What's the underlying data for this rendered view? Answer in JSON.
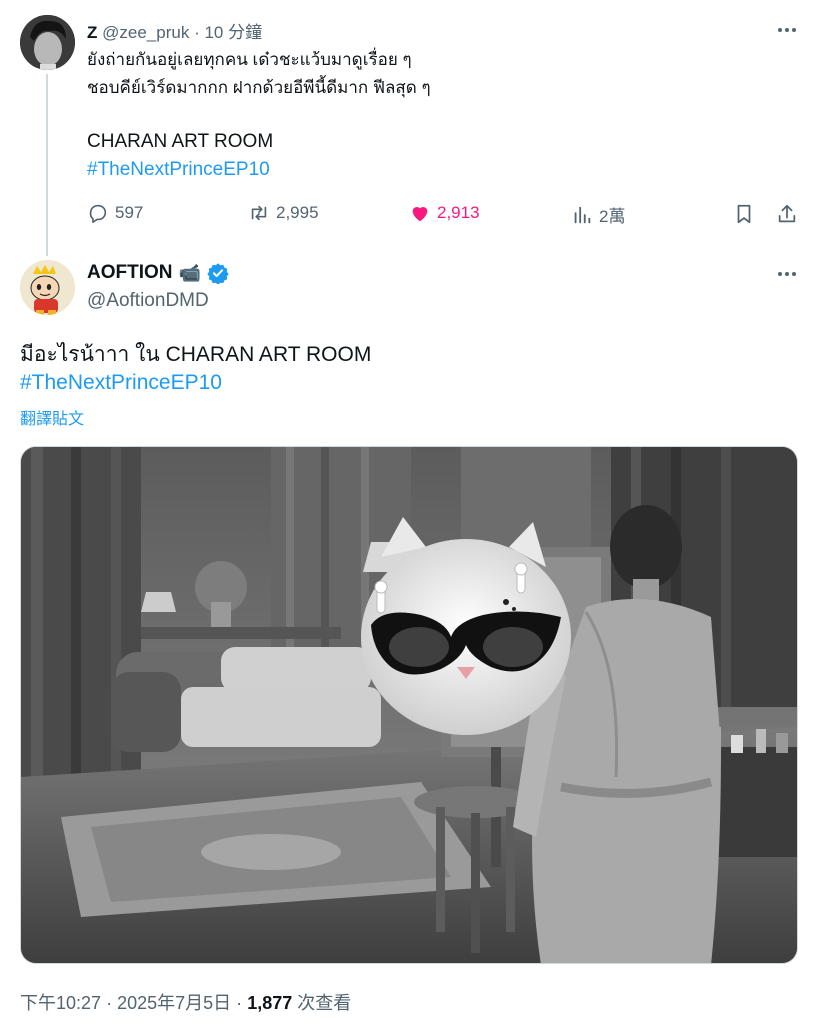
{
  "reply_tweet": {
    "display_name": "Z",
    "handle": "@zee_pruk",
    "separator": "·",
    "time": "10 分鐘",
    "lines": [
      "ยังถ่ายกันอยู่เลยทุกคน เด๋วชะแว้บมาดูเรื่อย ๆ",
      "ชอบคีย์เวิร์ดมากกก ฝากด้วยอีพีนี้ดีมาก ฟีลสุด ๆ"
    ],
    "location": "CHARAN ART ROOM",
    "hashtag": "#TheNextPrinceEP10",
    "replies": "597",
    "retweets": "2,995",
    "likes": "2,913",
    "views": "2萬",
    "colors": {
      "like": "#f91880",
      "link": "#1d9bf0"
    }
  },
  "main_tweet": {
    "display_name": "AOFTION",
    "name_emoji": "📹",
    "verified_icon": "verified-badge-icon",
    "handle": "@AoftionDMD",
    "text": "มีอะไรน้าาา ใน CHARAN ART ROOM",
    "hashtag": "#TheNextPrinceEP10",
    "translate_label": "翻譯貼文",
    "photo_icons": [
      "cat-sticker-with-sunglasses",
      "person-in-bathrobe",
      "living-room"
    ],
    "time": "下午10:27",
    "date": "2025年7月5日",
    "separator": "·",
    "view_count": "1,877",
    "view_label": "次查看"
  }
}
